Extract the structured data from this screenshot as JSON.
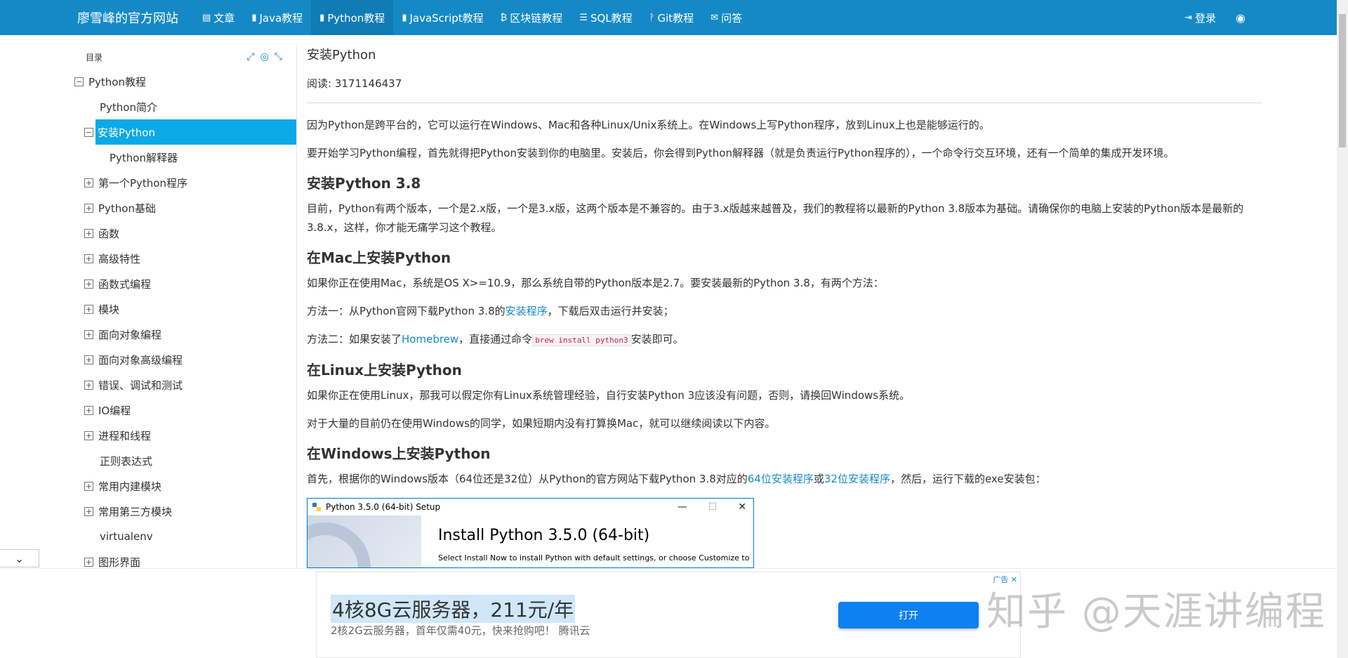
{
  "navbar": {
    "brand": "廖雪峰的官方网站",
    "items": [
      {
        "icon": "article-icon",
        "glyph": "▤",
        "label": "文章"
      },
      {
        "icon": "book-icon",
        "glyph": "▮",
        "label": "Java教程"
      },
      {
        "icon": "book-icon",
        "glyph": "▮",
        "label": "Python教程"
      },
      {
        "icon": "book-icon",
        "glyph": "▮",
        "label": "JavaScript教程"
      },
      {
        "icon": "bitcoin-icon",
        "glyph": "₿",
        "label": "区块链教程"
      },
      {
        "icon": "database-icon",
        "glyph": "☰",
        "label": "SQL教程"
      },
      {
        "icon": "git-icon",
        "glyph": "ᚹ",
        "label": "Git教程"
      },
      {
        "icon": "chat-icon",
        "glyph": "✉",
        "label": "问答"
      }
    ],
    "login": "登录",
    "login_glyph": "⇥",
    "globe_glyph": "◉"
  },
  "sidebar": {
    "header": "目录",
    "tools": {
      "expand": "⤢",
      "locate": "◎",
      "collapse": "⤡"
    },
    "items": [
      {
        "label": "Python教程",
        "box": "−"
      },
      {
        "label": "Python简介",
        "box": ""
      },
      {
        "label": "安装Python",
        "box": "−"
      },
      {
        "label": "Python解释器",
        "box": ""
      },
      {
        "label": "第一个Python程序",
        "box": "+"
      },
      {
        "label": "Python基础",
        "box": "+"
      },
      {
        "label": "函数",
        "box": "+"
      },
      {
        "label": "高级特性",
        "box": "+"
      },
      {
        "label": "函数式编程",
        "box": "+"
      },
      {
        "label": "模块",
        "box": "+"
      },
      {
        "label": "面向对象编程",
        "box": "+"
      },
      {
        "label": "面向对象高级编程",
        "box": "+"
      },
      {
        "label": "错误、调试和测试",
        "box": "+"
      },
      {
        "label": "IO编程",
        "box": "+"
      },
      {
        "label": "进程和线程",
        "box": "+"
      },
      {
        "label": "正则表达式",
        "box": ""
      },
      {
        "label": "常用内建模块",
        "box": "+"
      },
      {
        "label": "常用第三方模块",
        "box": "+"
      },
      {
        "label": "virtualenv",
        "box": ""
      },
      {
        "label": "图形界面",
        "box": "+"
      }
    ],
    "collapse_glyph": "⌄"
  },
  "article": {
    "title": "安装Python",
    "reads": "阅读: 3171146437",
    "p1": "因为Python是跨平台的，它可以运行在Windows、Mac和各种Linux/Unix系统上。在Windows上写Python程序，放到Linux上也是能够运行的。",
    "p2": "要开始学习Python编程，首先就得把Python安装到你的电脑里。安装后，你会得到Python解释器（就是负责运行Python程序的），一个命令行交互环境，还有一个简单的集成开发环境。",
    "h_install38": "安装Python 3.8",
    "p3": "目前，Python有两个版本，一个是2.x版，一个是3.x版，这两个版本是不兼容的。由于3.x版越来越普及，我们的教程将以最新的Python 3.8版本为基础。请确保你的电脑上安装的Python版本是最新的3.8.x，这样，你才能无痛学习这个教程。",
    "h_mac": "在Mac上安装Python",
    "p_mac": "如果你正在使用Mac，系统是OS X>=10.9，那么系统自带的Python版本是2.7。要安装最新的Python 3.8，有两个方法：",
    "m1_pre": "方法一：从Python官网下载Python 3.8的",
    "m1_link": "安装程序",
    "m1_post": "，下载后双击运行并安装；",
    "m2_pre": "方法二：如果安装了",
    "m2_link": "Homebrew",
    "m2_mid": "，直接通过命令",
    "m2_code": "brew install python3",
    "m2_post": "安装即可。",
    "h_linux": "在Linux上安装Python",
    "p_linux1": "如果你正在使用Linux，那我可以假定你有Linux系统管理经验，自行安装Python 3应该没有问题，否则，请换回Windows系统。",
    "p_linux2": "对于大量的目前仍在使用Windows的同学，如果短期内没有打算换Mac，就可以继续阅读以下内容。",
    "h_win": "在Windows上安装Python",
    "win_pre": "首先，根据你的Windows版本（64位还是32位）从Python的官方网站下载Python 3.8对应的",
    "win_link64": "64位安装程序",
    "win_or": "或",
    "win_link32": "32位安装程序",
    "win_post": "，然后，运行下载的exe安装包：",
    "installer": {
      "window_title": "Python 3.5.0 (64-bit) Setup",
      "min": "—",
      "max": "☐",
      "close": "✕",
      "heading": "Install Python 3.5.0 (64-bit)",
      "sub": "Select Install Now to install Python with default settings, or choose Customize to"
    }
  },
  "ad": {
    "tag": "广告 ✕",
    "title": "4核8G云服务器，211元/年",
    "sub": "2核2G云服务器，首年仅需40元，快来抢购吧！ 腾讯云",
    "button": "打开"
  },
  "watermark": "知乎 @天涯讲编程",
  "colors": {
    "navbar": "#1589c6",
    "selected": "#0ba9e6",
    "link": "#1589c6",
    "ad_button": "#0e81f2"
  }
}
